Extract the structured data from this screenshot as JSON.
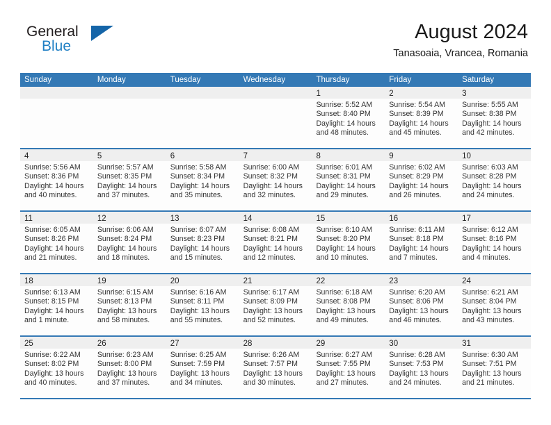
{
  "brand": {
    "name_part1": "General",
    "name_part2": "Blue",
    "triangle_icon": "triangle-logo-icon"
  },
  "header": {
    "month_title": "August 2024",
    "location": "Tanasoaia, Vrancea, Romania"
  },
  "calendar": {
    "weekdays": [
      "Sunday",
      "Monday",
      "Tuesday",
      "Wednesday",
      "Thursday",
      "Friday",
      "Saturday"
    ],
    "colors": {
      "header_blue": "#3479b5",
      "day_band_gray": "#efefef",
      "brand_blue": "#1f7fc4",
      "cell_background": "#fdfdfd"
    },
    "weeks": [
      [
        {
          "day": "",
          "lines": []
        },
        {
          "day": "",
          "lines": []
        },
        {
          "day": "",
          "lines": []
        },
        {
          "day": "",
          "lines": []
        },
        {
          "day": "1",
          "lines": [
            "Sunrise: 5:52 AM",
            "Sunset: 8:40 PM",
            "Daylight: 14 hours",
            "and 48 minutes."
          ]
        },
        {
          "day": "2",
          "lines": [
            "Sunrise: 5:54 AM",
            "Sunset: 8:39 PM",
            "Daylight: 14 hours",
            "and 45 minutes."
          ]
        },
        {
          "day": "3",
          "lines": [
            "Sunrise: 5:55 AM",
            "Sunset: 8:38 PM",
            "Daylight: 14 hours",
            "and 42 minutes."
          ]
        }
      ],
      [
        {
          "day": "4",
          "lines": [
            "Sunrise: 5:56 AM",
            "Sunset: 8:36 PM",
            "Daylight: 14 hours",
            "and 40 minutes."
          ]
        },
        {
          "day": "5",
          "lines": [
            "Sunrise: 5:57 AM",
            "Sunset: 8:35 PM",
            "Daylight: 14 hours",
            "and 37 minutes."
          ]
        },
        {
          "day": "6",
          "lines": [
            "Sunrise: 5:58 AM",
            "Sunset: 8:34 PM",
            "Daylight: 14 hours",
            "and 35 minutes."
          ]
        },
        {
          "day": "7",
          "lines": [
            "Sunrise: 6:00 AM",
            "Sunset: 8:32 PM",
            "Daylight: 14 hours",
            "and 32 minutes."
          ]
        },
        {
          "day": "8",
          "lines": [
            "Sunrise: 6:01 AM",
            "Sunset: 8:31 PM",
            "Daylight: 14 hours",
            "and 29 minutes."
          ]
        },
        {
          "day": "9",
          "lines": [
            "Sunrise: 6:02 AM",
            "Sunset: 8:29 PM",
            "Daylight: 14 hours",
            "and 26 minutes."
          ]
        },
        {
          "day": "10",
          "lines": [
            "Sunrise: 6:03 AM",
            "Sunset: 8:28 PM",
            "Daylight: 14 hours",
            "and 24 minutes."
          ]
        }
      ],
      [
        {
          "day": "11",
          "lines": [
            "Sunrise: 6:05 AM",
            "Sunset: 8:26 PM",
            "Daylight: 14 hours",
            "and 21 minutes."
          ]
        },
        {
          "day": "12",
          "lines": [
            "Sunrise: 6:06 AM",
            "Sunset: 8:24 PM",
            "Daylight: 14 hours",
            "and 18 minutes."
          ]
        },
        {
          "day": "13",
          "lines": [
            "Sunrise: 6:07 AM",
            "Sunset: 8:23 PM",
            "Daylight: 14 hours",
            "and 15 minutes."
          ]
        },
        {
          "day": "14",
          "lines": [
            "Sunrise: 6:08 AM",
            "Sunset: 8:21 PM",
            "Daylight: 14 hours",
            "and 12 minutes."
          ]
        },
        {
          "day": "15",
          "lines": [
            "Sunrise: 6:10 AM",
            "Sunset: 8:20 PM",
            "Daylight: 14 hours",
            "and 10 minutes."
          ]
        },
        {
          "day": "16",
          "lines": [
            "Sunrise: 6:11 AM",
            "Sunset: 8:18 PM",
            "Daylight: 14 hours",
            "and 7 minutes."
          ]
        },
        {
          "day": "17",
          "lines": [
            "Sunrise: 6:12 AM",
            "Sunset: 8:16 PM",
            "Daylight: 14 hours",
            "and 4 minutes."
          ]
        }
      ],
      [
        {
          "day": "18",
          "lines": [
            "Sunrise: 6:13 AM",
            "Sunset: 8:15 PM",
            "Daylight: 14 hours",
            "and 1 minute."
          ]
        },
        {
          "day": "19",
          "lines": [
            "Sunrise: 6:15 AM",
            "Sunset: 8:13 PM",
            "Daylight: 13 hours",
            "and 58 minutes."
          ]
        },
        {
          "day": "20",
          "lines": [
            "Sunrise: 6:16 AM",
            "Sunset: 8:11 PM",
            "Daylight: 13 hours",
            "and 55 minutes."
          ]
        },
        {
          "day": "21",
          "lines": [
            "Sunrise: 6:17 AM",
            "Sunset: 8:09 PM",
            "Daylight: 13 hours",
            "and 52 minutes."
          ]
        },
        {
          "day": "22",
          "lines": [
            "Sunrise: 6:18 AM",
            "Sunset: 8:08 PM",
            "Daylight: 13 hours",
            "and 49 minutes."
          ]
        },
        {
          "day": "23",
          "lines": [
            "Sunrise: 6:20 AM",
            "Sunset: 8:06 PM",
            "Daylight: 13 hours",
            "and 46 minutes."
          ]
        },
        {
          "day": "24",
          "lines": [
            "Sunrise: 6:21 AM",
            "Sunset: 8:04 PM",
            "Daylight: 13 hours",
            "and 43 minutes."
          ]
        }
      ],
      [
        {
          "day": "25",
          "lines": [
            "Sunrise: 6:22 AM",
            "Sunset: 8:02 PM",
            "Daylight: 13 hours",
            "and 40 minutes."
          ]
        },
        {
          "day": "26",
          "lines": [
            "Sunrise: 6:23 AM",
            "Sunset: 8:00 PM",
            "Daylight: 13 hours",
            "and 37 minutes."
          ]
        },
        {
          "day": "27",
          "lines": [
            "Sunrise: 6:25 AM",
            "Sunset: 7:59 PM",
            "Daylight: 13 hours",
            "and 34 minutes."
          ]
        },
        {
          "day": "28",
          "lines": [
            "Sunrise: 6:26 AM",
            "Sunset: 7:57 PM",
            "Daylight: 13 hours",
            "and 30 minutes."
          ]
        },
        {
          "day": "29",
          "lines": [
            "Sunrise: 6:27 AM",
            "Sunset: 7:55 PM",
            "Daylight: 13 hours",
            "and 27 minutes."
          ]
        },
        {
          "day": "30",
          "lines": [
            "Sunrise: 6:28 AM",
            "Sunset: 7:53 PM",
            "Daylight: 13 hours",
            "and 24 minutes."
          ]
        },
        {
          "day": "31",
          "lines": [
            "Sunrise: 6:30 AM",
            "Sunset: 7:51 PM",
            "Daylight: 13 hours",
            "and 21 minutes."
          ]
        }
      ]
    ]
  }
}
